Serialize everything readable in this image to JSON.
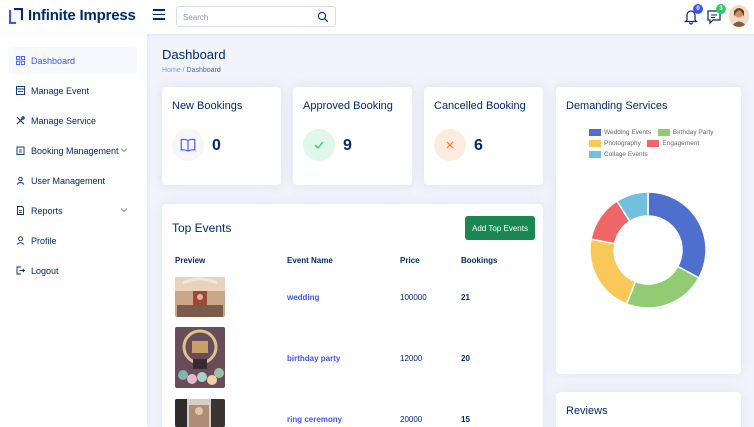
{
  "header": {
    "app_name": "Infinite Impress",
    "search_placeholder": "Search",
    "notification_count": "0",
    "message_count": "3"
  },
  "sidebar": {
    "items": [
      {
        "label": "Dashboard",
        "icon": "grid-icon"
      },
      {
        "label": "Manage Event",
        "icon": "list-icon"
      },
      {
        "label": "Manage Service",
        "icon": "tools-icon"
      },
      {
        "label": "Booking Management",
        "icon": "clipboard-icon"
      },
      {
        "label": "User Management",
        "icon": "users-icon"
      },
      {
        "label": "Reports",
        "icon": "report-icon"
      },
      {
        "label": "Profile",
        "icon": "person-icon"
      },
      {
        "label": "Logout",
        "icon": "logout-icon"
      }
    ]
  },
  "page": {
    "title": "Dashboard",
    "breadcrumb_home": "Home",
    "breadcrumb_sep": "/",
    "breadcrumb_current": "Dashboard"
  },
  "stats": [
    {
      "title": "New Bookings",
      "value": "0",
      "icon": "book-icon"
    },
    {
      "title": "Approved Booking",
      "value": "9",
      "icon": "check-icon"
    },
    {
      "title": "Cancelled Booking",
      "value": "6",
      "icon": "x-icon"
    }
  ],
  "top_events": {
    "title": "Top Events",
    "add_button": "Add Top Events",
    "headers": [
      "Preview",
      "Event Name",
      "Price",
      "Bookings"
    ],
    "rows": [
      {
        "name": "wedding",
        "price": "100000",
        "bookings": "21"
      },
      {
        "name": "birthday party",
        "price": "12000",
        "bookings": "20"
      },
      {
        "name": "ring ceremony",
        "price": "20000",
        "bookings": "15"
      }
    ]
  },
  "demanding": {
    "title": "Demanding Services",
    "legend": [
      {
        "label": "Wedding Events",
        "color": "#4e6fcb"
      },
      {
        "label": "Birthday Party",
        "color": "#91cc75"
      },
      {
        "label": "Photography",
        "color": "#fac858"
      },
      {
        "label": "Engagement",
        "color": "#ee6666"
      },
      {
        "label": "Collage Events",
        "color": "#73c0de"
      }
    ]
  },
  "reviews": {
    "title": "Reviews"
  },
  "chart_data": {
    "type": "pie",
    "labels": [
      "Wedding Events",
      "Birthday Party",
      "Photography",
      "Engagement",
      "Collage Events"
    ],
    "values": [
      33,
      23,
      22,
      13,
      9
    ],
    "colors": [
      "#4e6fcb",
      "#91cc75",
      "#fac858",
      "#ee6666",
      "#73c0de"
    ],
    "donut": true,
    "legend": "top"
  }
}
